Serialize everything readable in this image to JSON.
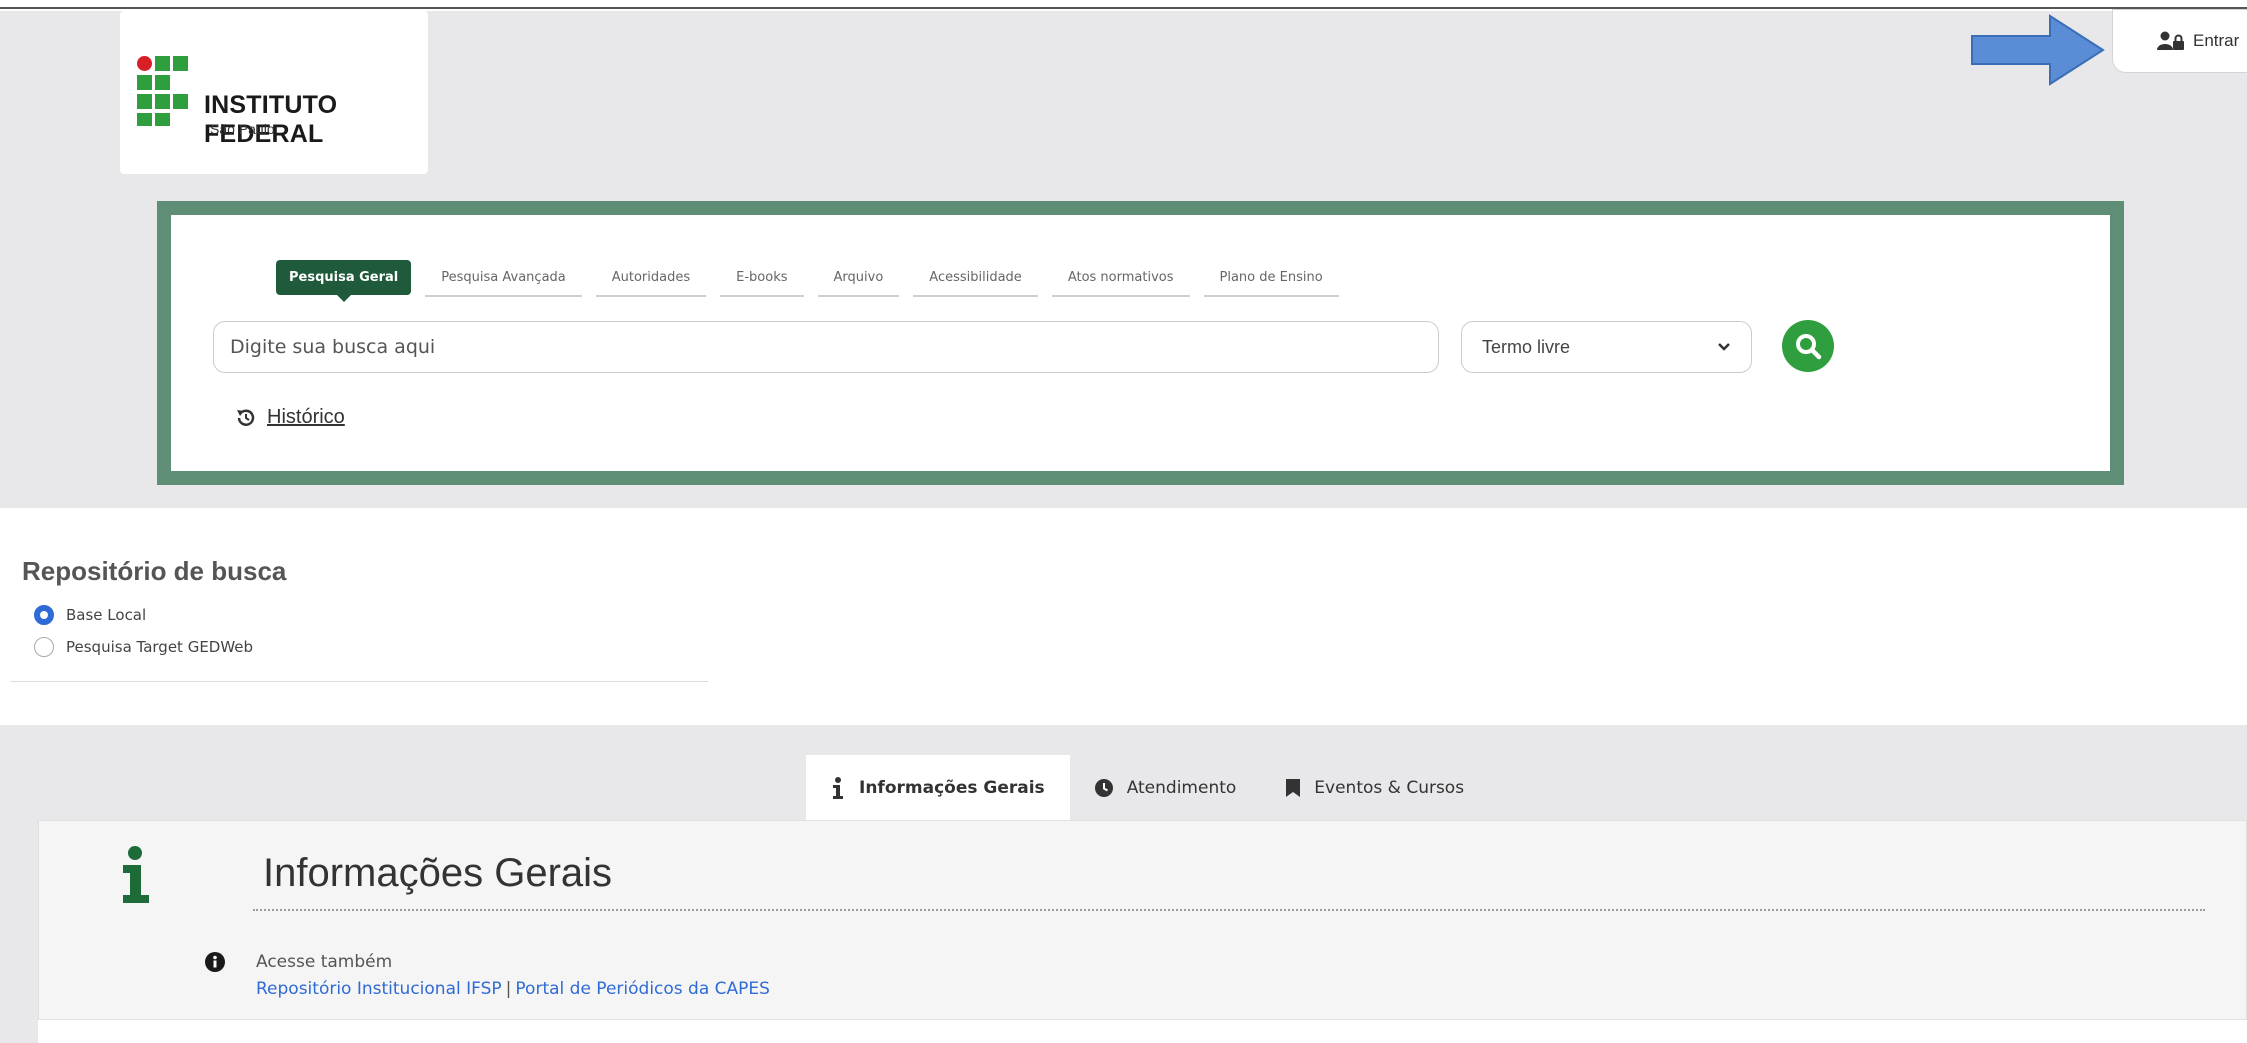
{
  "logo": {
    "name": "INSTITUTO FEDERAL",
    "subtitle": "São Paulo",
    "red_color": "#d81e26",
    "green_color": "#2e9e3e"
  },
  "header": {
    "login_label": "Entrar",
    "arrow_color": "#5b8dd6"
  },
  "search": {
    "tabs": [
      {
        "label": "Pesquisa Geral",
        "active": true
      },
      {
        "label": "Pesquisa Avançada"
      },
      {
        "label": "Autoridades"
      },
      {
        "label": "E-books"
      },
      {
        "label": "Arquivo"
      },
      {
        "label": "Acessibilidade"
      },
      {
        "label": "Atos normativos"
      },
      {
        "label": "Plano de Ensino"
      }
    ],
    "placeholder": "Digite sua busca aqui",
    "select_value": "Termo livre",
    "history_label": "Histórico",
    "frame_color": "#5f8e77",
    "active_tab_color": "#1f5b3a",
    "button_color": "#2e9e3e"
  },
  "repository": {
    "title": "Repositório de busca",
    "options": [
      {
        "label": "Base Local",
        "checked": true
      },
      {
        "label": "Pesquisa Target GEDWeb",
        "checked": false
      }
    ]
  },
  "info": {
    "tabs": [
      {
        "label": "Informações Gerais",
        "icon": "info-icon",
        "active": true
      },
      {
        "label": "Atendimento",
        "icon": "clock-icon"
      },
      {
        "label": "Eventos & Cursos",
        "icon": "bookmark-icon"
      }
    ],
    "title": "Informações Gerais",
    "note": "Acesse também",
    "links": [
      "Repositório Institucional IFSP",
      "Portal de Periódicos da CAPES"
    ],
    "link_color": "#2f6bd6"
  }
}
